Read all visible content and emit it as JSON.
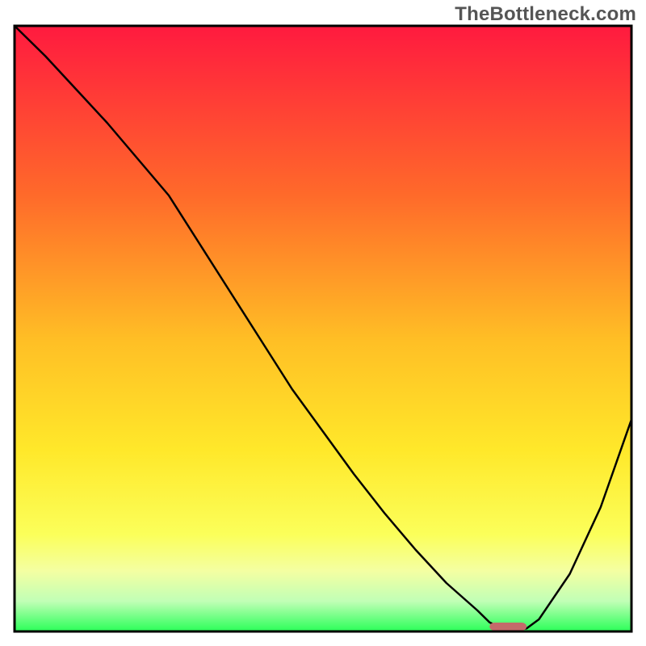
{
  "watermark": {
    "text": "TheBottleneck.com"
  },
  "chart_data": {
    "type": "line",
    "title": "",
    "xlabel": "",
    "ylabel": "",
    "xlim": [
      0,
      100
    ],
    "ylim": [
      0,
      100
    ],
    "series": [
      {
        "name": "bottleneck-curve",
        "x": [
          0,
          5,
          10,
          15,
          20,
          25,
          30,
          35,
          40,
          45,
          50,
          55,
          60,
          65,
          70,
          75,
          77,
          79,
          81,
          83,
          85,
          90,
          95,
          100
        ],
        "y": [
          100,
          95,
          89.5,
          84,
          78,
          72,
          64,
          56,
          48,
          40,
          33,
          26,
          19.5,
          13.5,
          8,
          3.5,
          1.5,
          0.5,
          0.2,
          0.5,
          2,
          9.5,
          20.5,
          35
        ]
      }
    ],
    "marker": {
      "name": "optimum-marker",
      "x_center": 80,
      "width_pct": 6,
      "height_pct": 1.2,
      "color": "#c46a6a"
    },
    "gradient_stops": [
      {
        "pct": 0,
        "color": "#ff1a3f"
      },
      {
        "pct": 28,
        "color": "#ff6a2a"
      },
      {
        "pct": 52,
        "color": "#ffbf25"
      },
      {
        "pct": 70,
        "color": "#ffe82a"
      },
      {
        "pct": 84,
        "color": "#fbff5a"
      },
      {
        "pct": 90,
        "color": "#f4ffa2"
      },
      {
        "pct": 95,
        "color": "#c1ffb6"
      },
      {
        "pct": 100,
        "color": "#2aff58"
      }
    ],
    "frame": {
      "stroke": "#000000",
      "thickness_px": 3
    }
  }
}
